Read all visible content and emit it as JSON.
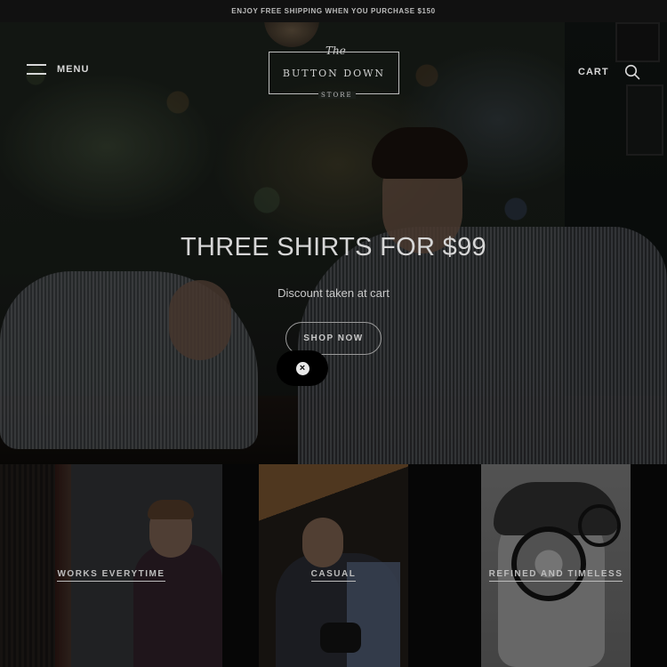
{
  "announcement": "ENJOY FREE SHIPPING WHEN YOU PURCHASE $150",
  "header": {
    "menu_label": "MENU",
    "logo": {
      "the": "The",
      "main": "BUTTON DOWN",
      "store": "STORE"
    },
    "cart_label": "CART"
  },
  "hero": {
    "title": "THREE SHIRTS FOR $99",
    "subtitle": "Discount taken at cart",
    "button_label": "SHOP NOW"
  },
  "close_icon": "×",
  "tiles": [
    {
      "label": "WORKS EVERYTIME"
    },
    {
      "label": "CASUAL"
    },
    {
      "label": "REFINED AND TIMELESS"
    }
  ],
  "icons": [
    "hamburger-icon",
    "search-icon",
    "close-icon"
  ]
}
